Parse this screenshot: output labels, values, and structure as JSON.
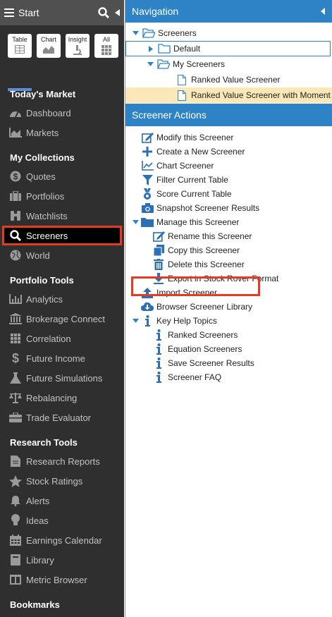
{
  "sidebar": {
    "title": "Start",
    "tabs": [
      {
        "label": "Table",
        "icon": "table-icon"
      },
      {
        "label": "Chart",
        "icon": "chart-icon"
      },
      {
        "label": "Insight",
        "icon": "microscope-icon"
      },
      {
        "label": "All",
        "icon": "grid-icon"
      }
    ],
    "sections": [
      {
        "title": "Today's Market",
        "items": [
          {
            "label": "Dashboard",
            "icon": "dashboard-icon"
          },
          {
            "label": "Markets",
            "icon": "area-chart-icon"
          }
        ]
      },
      {
        "title": "My Collections",
        "items": [
          {
            "label": "Quotes",
            "icon": "dollar-circle-icon"
          },
          {
            "label": "Portfolios",
            "icon": "briefcase-icon"
          },
          {
            "label": "Watchlists",
            "icon": "binoculars-icon"
          },
          {
            "label": "Screeners",
            "icon": "search-icon",
            "active": true
          },
          {
            "label": "World",
            "icon": "globe-icon"
          }
        ]
      },
      {
        "title": "Portfolio Tools",
        "items": [
          {
            "label": "Analytics",
            "icon": "bar-chart-icon"
          },
          {
            "label": "Brokerage Connect",
            "icon": "bank-icon"
          },
          {
            "label": "Correlation",
            "icon": "grid-icon"
          },
          {
            "label": "Future Income",
            "icon": "dollar-icon"
          },
          {
            "label": "Future Simulations",
            "icon": "flask-icon"
          },
          {
            "label": "Rebalancing",
            "icon": "scale-icon"
          },
          {
            "label": "Trade Evaluator",
            "icon": "toolbox-icon"
          }
        ]
      },
      {
        "title": "Research Tools",
        "items": [
          {
            "label": "Research Reports",
            "icon": "document-icon"
          },
          {
            "label": "Stock Ratings",
            "icon": "star-icon"
          },
          {
            "label": "Alerts",
            "icon": "bell-icon"
          },
          {
            "label": "Ideas",
            "icon": "lightbulb-icon"
          },
          {
            "label": "Earnings Calendar",
            "icon": "calendar-icon"
          },
          {
            "label": "Library",
            "icon": "book-icon"
          },
          {
            "label": "Metric Browser",
            "icon": "columns-icon"
          }
        ]
      },
      {
        "title": "Bookmarks",
        "items": []
      }
    ]
  },
  "navigation": {
    "title": "Navigation",
    "tree": [
      {
        "label": "Screeners",
        "level": 0,
        "toggle": "expanded",
        "icon": "folder-open-icon"
      },
      {
        "label": "Default",
        "level": 1,
        "toggle": "collapsed",
        "icon": "folder-icon",
        "boxed": true
      },
      {
        "label": "My Screeners",
        "level": 1,
        "toggle": "expanded",
        "icon": "folder-open-icon"
      },
      {
        "label": "Ranked Value Screener",
        "level": 2,
        "toggle": "none",
        "icon": "file-icon"
      },
      {
        "label": "Ranked Value Screener with Moment",
        "level": 2,
        "toggle": "none",
        "icon": "file-icon",
        "selected": true
      }
    ]
  },
  "actions": {
    "title": "Screener Actions",
    "items": [
      {
        "label": "Modify this Screener",
        "level": 0,
        "toggle": "none",
        "icon": "edit-icon"
      },
      {
        "label": "Create a New Screener",
        "level": 0,
        "toggle": "none",
        "icon": "plus-icon"
      },
      {
        "label": "Chart Screener",
        "level": 0,
        "toggle": "none",
        "icon": "line-chart-icon"
      },
      {
        "label": "Filter Current Table",
        "level": 0,
        "toggle": "none",
        "icon": "filter-icon"
      },
      {
        "label": "Score Current Table",
        "level": 0,
        "toggle": "none",
        "icon": "medal-icon"
      },
      {
        "label": "Snapshot Screener Results",
        "level": 0,
        "toggle": "none",
        "icon": "camera-icon"
      },
      {
        "label": "Manage this Screener",
        "level": 0,
        "toggle": "expanded",
        "icon": "folder-icon"
      },
      {
        "label": "Rename this Screener",
        "level": 1,
        "toggle": "none",
        "icon": "edit-icon"
      },
      {
        "label": "Copy this Screener",
        "level": 1,
        "toggle": "none",
        "icon": "copy-icon"
      },
      {
        "label": "Delete this Screener",
        "level": 1,
        "toggle": "none",
        "icon": "trash-icon"
      },
      {
        "label": "Export in Stock Rover Format",
        "level": 1,
        "toggle": "none",
        "icon": "download-icon"
      },
      {
        "label": "Import Screener",
        "level": 0,
        "toggle": "none",
        "icon": "upload-icon"
      },
      {
        "label": "Browser Screener Library",
        "level": 0,
        "toggle": "none",
        "icon": "cloud-download-icon"
      },
      {
        "label": "Key Help Topics",
        "level": 0,
        "toggle": "expanded",
        "icon": "info-icon"
      },
      {
        "label": "Ranked Screeners",
        "level": 1,
        "toggle": "none",
        "icon": "info-icon"
      },
      {
        "label": "Equation Screeners",
        "level": 1,
        "toggle": "none",
        "icon": "info-icon"
      },
      {
        "label": "Save Screener Results",
        "level": 1,
        "toggle": "none",
        "icon": "info-icon"
      },
      {
        "label": "Screener FAQ",
        "level": 1,
        "toggle": "none",
        "icon": "info-icon"
      }
    ]
  },
  "colors": {
    "accent": "#2d83c6",
    "highlight": "#e53b21",
    "selected_row": "#fbe8b8",
    "sidebar_bg": "#2f2f2f"
  }
}
